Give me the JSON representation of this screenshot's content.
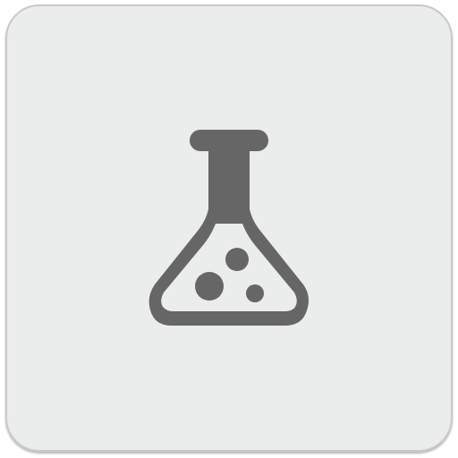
{
  "app_icon": {
    "icon_name": "flask-icon",
    "tile_color": "#ebecec",
    "icon_color": "#666666"
  }
}
